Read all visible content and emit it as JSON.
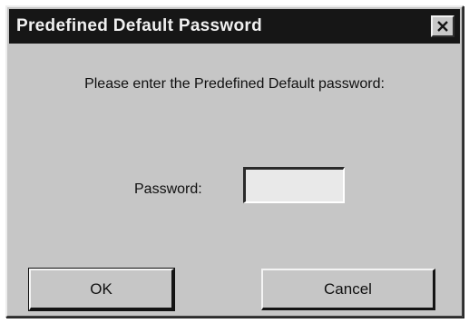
{
  "window": {
    "title": "Predefined Default Password",
    "close_icon": "close-icon"
  },
  "dialog": {
    "prompt": "Please enter the Predefined Default password:",
    "password_label": "Password:",
    "password_value": "",
    "ok_label": "OK",
    "cancel_label": "Cancel"
  },
  "colors": {
    "face": "#c6c6c6",
    "titlebar": "#161616",
    "title_text": "#f0f0f0"
  }
}
